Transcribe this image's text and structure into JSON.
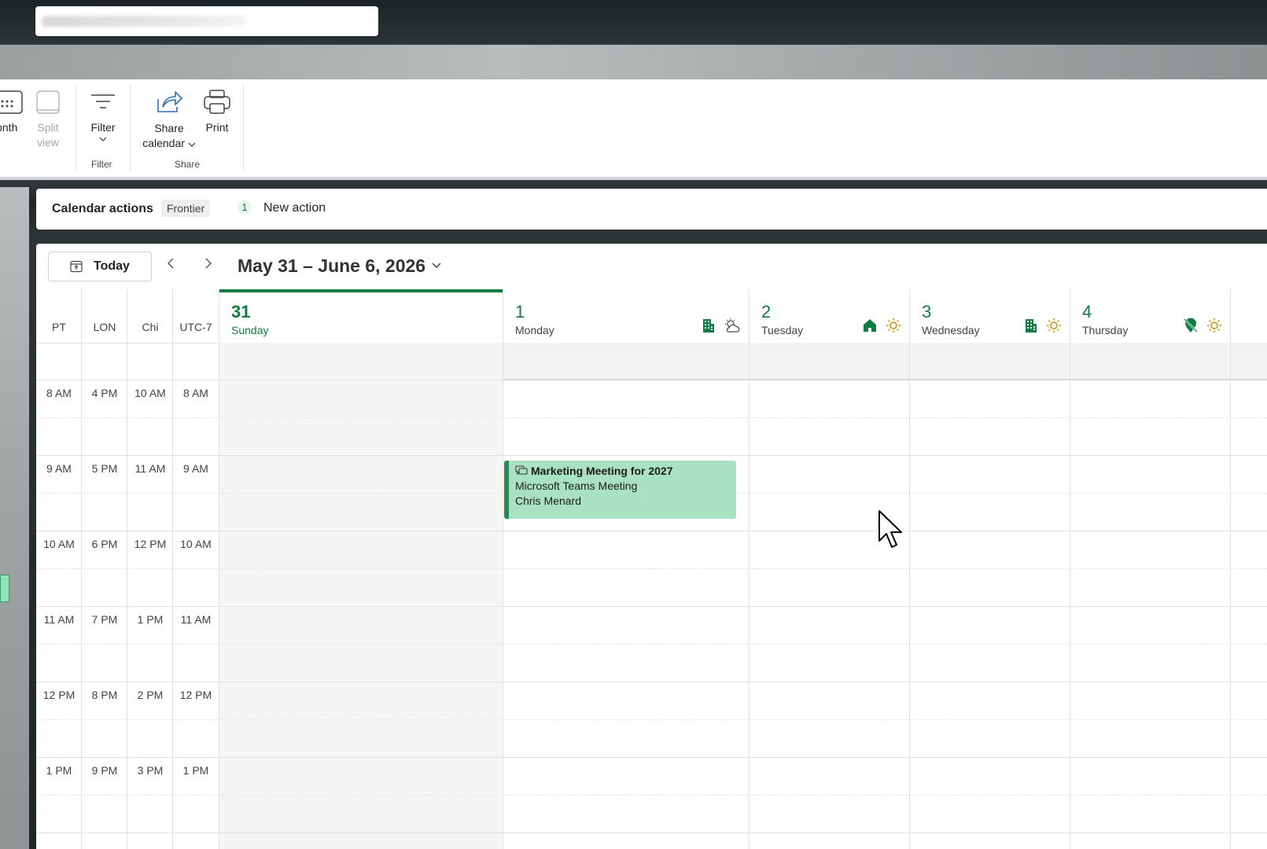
{
  "ribbon": {
    "month_label": "lonth",
    "split_label_1": "Split",
    "split_label_2": "view",
    "filter_label": "Filter",
    "filter_group": "Filter",
    "share_label_1": "Share",
    "share_label_2": "calendar",
    "print_label": "Print",
    "share_group": "Share"
  },
  "actions_bar": {
    "title": "Calendar actions",
    "badge": "Frontier",
    "count": "1",
    "new_action": "New action"
  },
  "calendar": {
    "today_label": "Today",
    "date_range": "May 31 – June 6, 2026",
    "timezones": [
      "PT",
      "LON",
      "Chi",
      "UTC-7"
    ],
    "days": [
      {
        "num": "31",
        "name": "Sunday",
        "icons": []
      },
      {
        "num": "1",
        "name": "Monday",
        "icons": [
          "office-building-icon",
          "partly-cloudy-icon"
        ]
      },
      {
        "num": "2",
        "name": "Tuesday",
        "icons": [
          "home-icon",
          "sun-icon"
        ]
      },
      {
        "num": "3",
        "name": "Wednesday",
        "icons": [
          "office-building-icon",
          "sun-icon"
        ]
      },
      {
        "num": "4",
        "name": "Thursday",
        "icons": [
          "location-off-icon",
          "sun-icon"
        ]
      }
    ],
    "time_rows": [
      [
        "8 AM",
        "4 PM",
        "10 AM",
        "8 AM"
      ],
      [
        "9 AM",
        "5 PM",
        "11 AM",
        "9 AM"
      ],
      [
        "10 AM",
        "6 PM",
        "12 PM",
        "10 AM"
      ],
      [
        "11 AM",
        "7 PM",
        "1 PM",
        "11 AM"
      ],
      [
        "12 PM",
        "8 PM",
        "2 PM",
        "12 PM"
      ],
      [
        "1 PM",
        "9 PM",
        "3 PM",
        "1 PM"
      ]
    ],
    "event": {
      "title": "Marketing Meeting for 2027",
      "location": "Microsoft Teams Meeting",
      "organizer": "Chris Menard"
    }
  },
  "colors": {
    "accent": "#107c41",
    "event_fill": "#a8e2c3"
  }
}
